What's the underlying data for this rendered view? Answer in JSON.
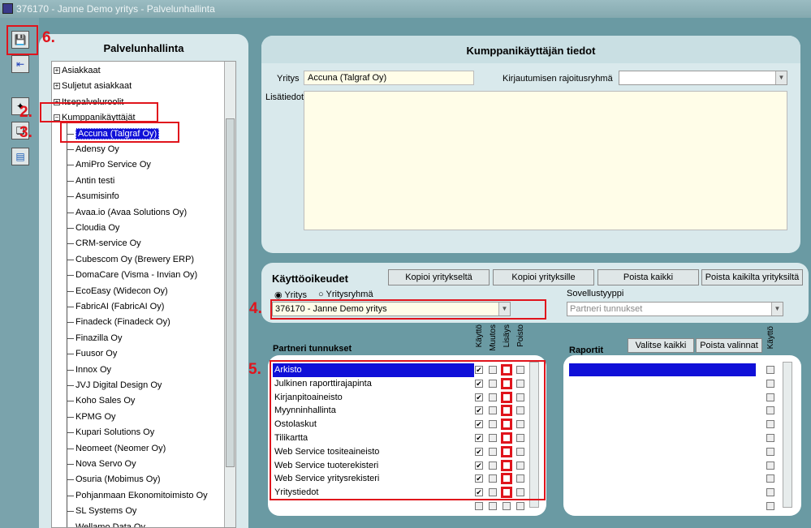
{
  "window": {
    "title": "376170 - Janne Demo yritys - Palvelunhallinta"
  },
  "left": {
    "title": "Palvelunhallinta",
    "top_nodes": [
      "Asiakkaat",
      "Suljetut asiakkaat",
      "Itsepalveluroolit",
      "Kumppanikäyttäjät"
    ],
    "partners": [
      "Accuna (Talgraf Oy)",
      "Adensy Oy",
      "AmiPro Service Oy",
      "Antin testi",
      "Asumisinfo",
      "Avaa.io (Avaa Solutions Oy)",
      "Cloudia Oy",
      "CRM-service Oy",
      "Cubescom Oy (Brewery ERP)",
      "DomaCare (Visma - Invian Oy)",
      "EcoEasy (Widecon Oy)",
      "FabricAI (FabricAI Oy)",
      "Finadeck (Finadeck Oy)",
      "Finazilla Oy",
      "Fuusor Oy",
      "Innox Oy",
      "JVJ Digital Design Oy",
      "Koho Sales Oy",
      "KPMG Oy",
      "Kupari Solutions Oy",
      "Neomeet (Neomer Oy)",
      "Nova Servo Oy",
      "Osuria (Mobimus Oy)",
      "Pohjanmaan Ekonomitoimisto Oy",
      "SL Systems Oy",
      "Wellamo Data Oy"
    ]
  },
  "info": {
    "header": "Kumppanikäyttäjän tiedot",
    "company_label": "Yritys",
    "company_value": "Accuna (Talgraf Oy)",
    "login_group_label": "Kirjautumisen rajoitusryhmä",
    "notes_label": "Lisätiedot"
  },
  "rights": {
    "title": "Käyttöoikeudet",
    "buttons": [
      "Kopioi yritykseltä",
      "Kopioi yrityksille",
      "Poista kaikki",
      "Poista kaikilta yrityksiltä"
    ],
    "radio_company": "Yritys",
    "radio_group": "Yritysryhmä",
    "company_select": "376170 - Janne Demo yritys",
    "app_type_label": "Sovellustyyppi",
    "app_type_value": "Partneri tunnukset"
  },
  "partner_list": {
    "title": "Partneri tunnukset",
    "col_headers": [
      "Käyttö",
      "Muutos",
      "Lisäys",
      "Poisto"
    ],
    "rows": [
      "Arkisto",
      "Julkinen raporttirajapinta",
      "Kirjanpitoaineisto",
      "Myynninhallinta",
      "Ostolaskut",
      "Tilikartta",
      "Web Service tositeaineisto",
      "Web Service tuoterekisteri",
      "Web Service yritysrekisteri",
      "Yritystiedot"
    ]
  },
  "reports": {
    "title": "Raportit",
    "select_all": "Valitse kaikki",
    "clear": "Poista valinnat",
    "col_header": "Käyttö"
  },
  "annotations": [
    "6.",
    "2.",
    "3.",
    "4.",
    "5."
  ]
}
